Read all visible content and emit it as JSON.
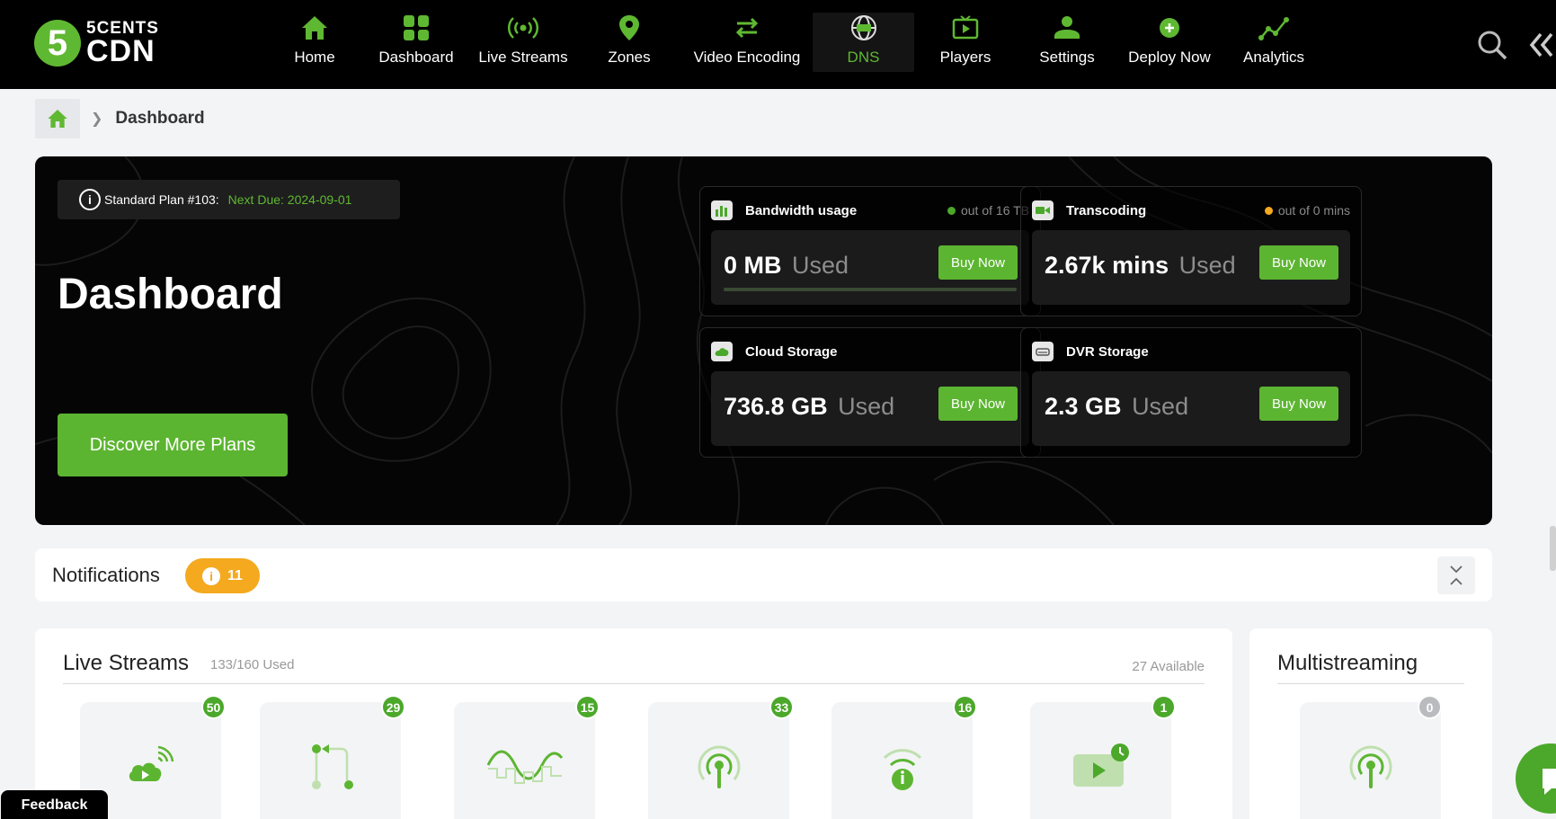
{
  "brand": {
    "line1": "5CENTS",
    "line2": "CDN",
    "badge": "5"
  },
  "nav": [
    {
      "label": "Home",
      "icon": "home-icon"
    },
    {
      "label": "Dashboard",
      "icon": "dashboard-icon"
    },
    {
      "label": "Live Streams",
      "icon": "live-streams-icon"
    },
    {
      "label": "Zones",
      "icon": "location-pin-icon"
    },
    {
      "label": "Video Encoding",
      "icon": "encoding-icon"
    },
    {
      "label": "DNS",
      "icon": "globe-icon"
    },
    {
      "label": "Players",
      "icon": "player-icon"
    },
    {
      "label": "Settings",
      "icon": "settings-icon"
    },
    {
      "label": "Deploy Now",
      "icon": "plus-circle-icon"
    },
    {
      "label": "Analytics",
      "icon": "analytics-icon"
    }
  ],
  "active_nav": "DNS",
  "breadcrumb": {
    "current": "Dashboard"
  },
  "hero": {
    "plan_label": "Standard Plan #103:",
    "next_due": "Next Due: 2024-09-01",
    "title": "Dashboard",
    "discover_label": "Discover More Plans",
    "stats": [
      {
        "title": "Bandwidth usage",
        "quota": "out of 16 TB",
        "dot_color": "#4ba82a",
        "value": "0 MB",
        "used": "Used",
        "buy": "Buy Now",
        "progress": 0
      },
      {
        "title": "Transcoding",
        "quota": "out of 0 mins",
        "dot_color": "#f4a91f",
        "value": "2.67k mins",
        "used": "Used",
        "buy": "Buy Now"
      },
      {
        "title": "Cloud Storage",
        "quota": "",
        "value": "736.8 GB",
        "used": "Used",
        "buy": "Buy Now"
      },
      {
        "title": "DVR Storage",
        "quota": "",
        "value": "2.3 GB",
        "used": "Used",
        "buy": "Buy Now"
      }
    ]
  },
  "notifications": {
    "title": "Notifications",
    "count": "11"
  },
  "live_streams": {
    "title": "Live Streams",
    "used": "133/160 Used",
    "available": "27 Available",
    "tiles": [
      {
        "icon": "cloud-broadcast-icon",
        "count": "50"
      },
      {
        "icon": "stream-routing-icon",
        "count": "29"
      },
      {
        "icon": "waveform-icon",
        "count": "15"
      },
      {
        "icon": "antenna-icon",
        "count": "33"
      },
      {
        "icon": "wifi-info-icon",
        "count": "16"
      },
      {
        "icon": "scheduled-video-icon",
        "count": "1"
      }
    ]
  },
  "multistreaming": {
    "title": "Multistreaming",
    "count": "0"
  },
  "feedback_label": "Feedback",
  "colors": {
    "accent": "#5cb531",
    "warning": "#f4a91f",
    "topbar": "#000000"
  }
}
